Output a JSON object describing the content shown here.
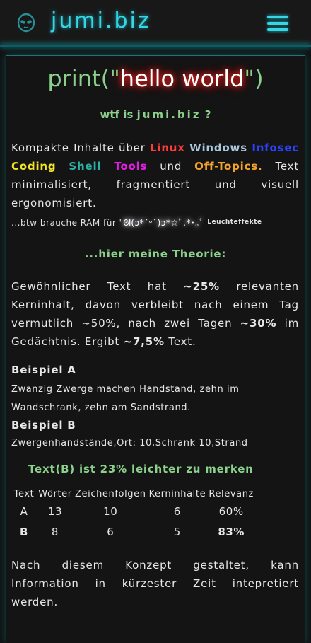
{
  "header": {
    "site_title": "jumi.biz",
    "logo_icon": "alien-head-icon",
    "menu_icon": "hamburger-menu-icon"
  },
  "main": {
    "print_prefix": "print(\"",
    "print_hello": "hello world",
    "print_suffix": "\")",
    "wtf_prefix": "wtf is",
    "wtf_site": "jumi.biz",
    "wtf_suffix": "?",
    "intro": {
      "t1": "Kompakte Inhalte über ",
      "linux": "Linux",
      "windows": "Windows",
      "infosec": "Infosec",
      "coding": "Coding",
      "shell": "Shell",
      "tools": "Tools",
      "und": "und",
      "off": "Off-Topics.",
      "t2": "Text minimalisiert, fragmentiert und visuell ergonomisiert."
    },
    "btw": {
      "text": "...btw brauche RAM für \"",
      "kaomoji": "ᘛ(ↄ*ˊᵕˋ)ↄ*☆ﾟ.*･｡ﾟ",
      "small": "Leuchteffekte"
    },
    "theory_heading": "...hier meine Theorie:",
    "theory": {
      "t1": "Gewöhnlicher Text hat ",
      "b1": "~25%",
      "t2": " relevanten Kerninhalt, davon verbleibt nach einem Tag vermutlich ~50%, nach zwei Tagen ",
      "b2": "~30%",
      "t3": " im Gedächtnis. Ergibt ",
      "b3": "~7,5%",
      "t4": " Text."
    },
    "example_a_heading": "Beispiel A",
    "example_a_text": "Zwanzig Zwerge machen Handstand, zehn im Wandschrank, zehn am Sandstrand.",
    "example_b_heading": "Beispiel B",
    "example_b_text": "Zwergenhandstände,Ort: 10,Schrank 10,Strand",
    "result": "Text(B) ist 23% leichter zu merken",
    "table": {
      "headers": [
        "Text",
        "Wörter",
        "Zeichenfolgen",
        "Kerninhalte",
        "Relevanz"
      ],
      "rows": [
        [
          "A",
          "13",
          "10",
          "6",
          "60%"
        ],
        [
          "B",
          "8",
          "6",
          "5",
          "83%"
        ]
      ]
    },
    "conclusion": "Nach diesem Konzept gestaltet, kann Information in kürzester Zeit intepretiert werden."
  }
}
